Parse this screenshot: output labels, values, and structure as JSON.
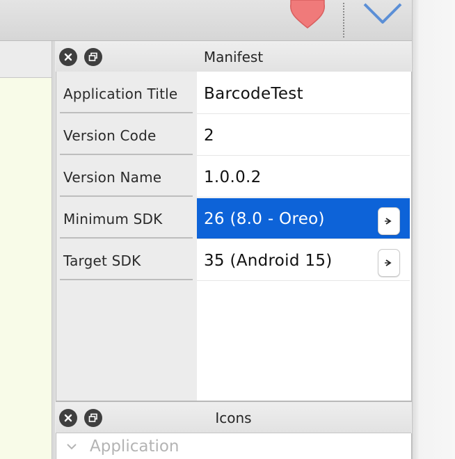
{
  "manifest_panel": {
    "title": "Manifest",
    "rows": [
      {
        "label": "Application Title",
        "value": "BarcodeTest"
      },
      {
        "label": "Version Code",
        "value": "2"
      },
      {
        "label": "Version Name",
        "value": "1.0.0.2"
      },
      {
        "label": "Minimum SDK",
        "value": "26 (8.0 - Oreo)"
      },
      {
        "label": "Target SDK",
        "value": "35 (Android 15)"
      }
    ]
  },
  "icons_panel": {
    "title": "Icons",
    "items": [
      {
        "label": "Application"
      }
    ]
  },
  "icons": {
    "favorite": "heart-icon",
    "expand": "chevron-down-icon",
    "close": "close-icon",
    "restore": "restore-window-icon",
    "stepper": "dropdown-arrow-icon"
  },
  "colors": {
    "selection": "#0d63d8",
    "heart": "#f07a7a",
    "chevron": "#5b8fd6"
  }
}
